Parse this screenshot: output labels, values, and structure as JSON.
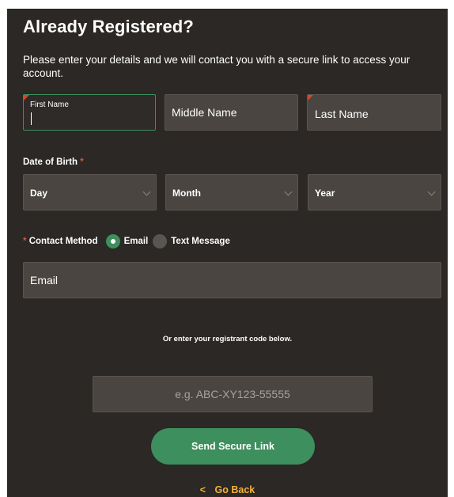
{
  "form": {
    "title": "Already Registered?",
    "subtitle": "Please enter your details and we will contact you with a secure link to access your account.",
    "first_name_label": "First Name",
    "middle_name_placeholder": "Middle Name",
    "last_name_placeholder": "Last Name",
    "dob_label": "Date of Birth",
    "required_mark": "*",
    "dob_day": "Day",
    "dob_month": "Month",
    "dob_year": "Year",
    "contact_method_label": "Contact Method",
    "contact_options": [
      "Email",
      "Text Message"
    ],
    "selected_contact": "Email",
    "email_placeholder": "Email",
    "or_text": "Or enter your registrant code below.",
    "code_placeholder": "e.g. ABC-XY123-55555",
    "submit_label": "Send Secure Link",
    "go_back_arrow": "<",
    "go_back_label": "Go Back"
  },
  "colors": {
    "panel_bg": "#2b2825",
    "field_bg": "#4a4540",
    "accent_green": "#3e8f5e",
    "required_red": "#e0503a",
    "link_gold": "#f3b23a"
  },
  "icons": [
    "chevron-down-icon",
    "chevron-left-icon",
    "radio-selected-icon",
    "radio-unselected-icon"
  ]
}
